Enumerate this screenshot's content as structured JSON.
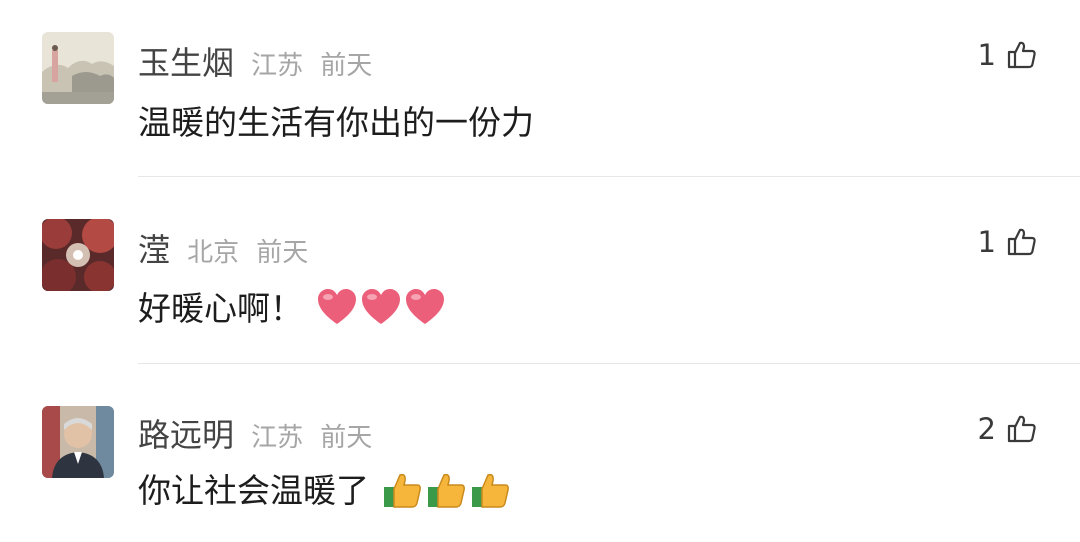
{
  "comments": [
    {
      "user": "玉生烟",
      "location": "江苏",
      "time": "前天",
      "text": "温暖的生活有你出的一份力",
      "likes": "1",
      "avatar_icon": "landscape-painting-avatar",
      "emojis": []
    },
    {
      "user": "滢",
      "location": "北京",
      "time": "前天",
      "text": "好暖心啊！",
      "likes": "1",
      "avatar_icon": "red-leaves-sun-avatar",
      "emojis": [
        "heart",
        "heart",
        "heart"
      ]
    },
    {
      "user": "路远明",
      "location": "江苏",
      "time": "前天",
      "text": "你让社会温暖了",
      "likes": "2",
      "avatar_icon": "elderly-man-avatar",
      "emojis": [
        "thumbs-up",
        "thumbs-up",
        "thumbs-up"
      ]
    }
  ],
  "colors": {
    "heart": "#ec5f7a",
    "thumb": "#f6b63b",
    "cuff": "#3a9a4a",
    "muted": "#a6a6a6",
    "divider": "#e7e7e7"
  }
}
